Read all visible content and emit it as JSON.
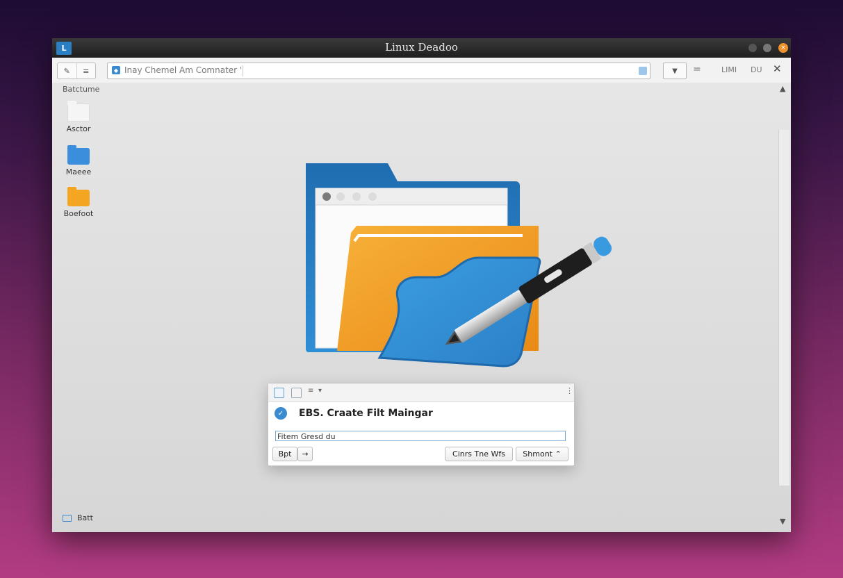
{
  "window": {
    "title": "Linux Deadoo",
    "app_icon": "L",
    "controls": [
      "minimize-icon",
      "maximize-icon",
      "close-icon"
    ]
  },
  "toolbar": {
    "back_icon": "✎",
    "list_icon": "≡",
    "address_text": "Inay Chemel Am Comnater '",
    "dropdown_icon": "▼",
    "menu_icon": "=",
    "item1": "LIMI",
    "item2": "DU",
    "close_icon": "✕"
  },
  "sidebar": {
    "header": "Batctume",
    "items": [
      {
        "label": "Asctor",
        "icon": "folder-white-icon"
      },
      {
        "label": "Maeee",
        "icon": "folder-blue-icon"
      },
      {
        "label": "Boefoot",
        "icon": "folder-orange-icon"
      }
    ],
    "bottom_item": {
      "label": "Batt",
      "icon": "drive-icon"
    }
  },
  "colors": {
    "accent_blue": "#2f86cf",
    "folder_orange": "#f39a1d",
    "window_bg": "#d9d9d9"
  },
  "dialog": {
    "title": "EBS. Craate Filt Maingar",
    "badge_icon": "✓",
    "input_value": "Fitem Gresd du",
    "button_left": "Bpt",
    "button_left_arrow": "→",
    "button_cancel": "Cinrs Tne Wfs",
    "button_ok": "Shmont ⌃",
    "toolbar_icons": [
      "new-file-icon",
      "document-icon",
      "filter-icon",
      "more-icon"
    ]
  }
}
